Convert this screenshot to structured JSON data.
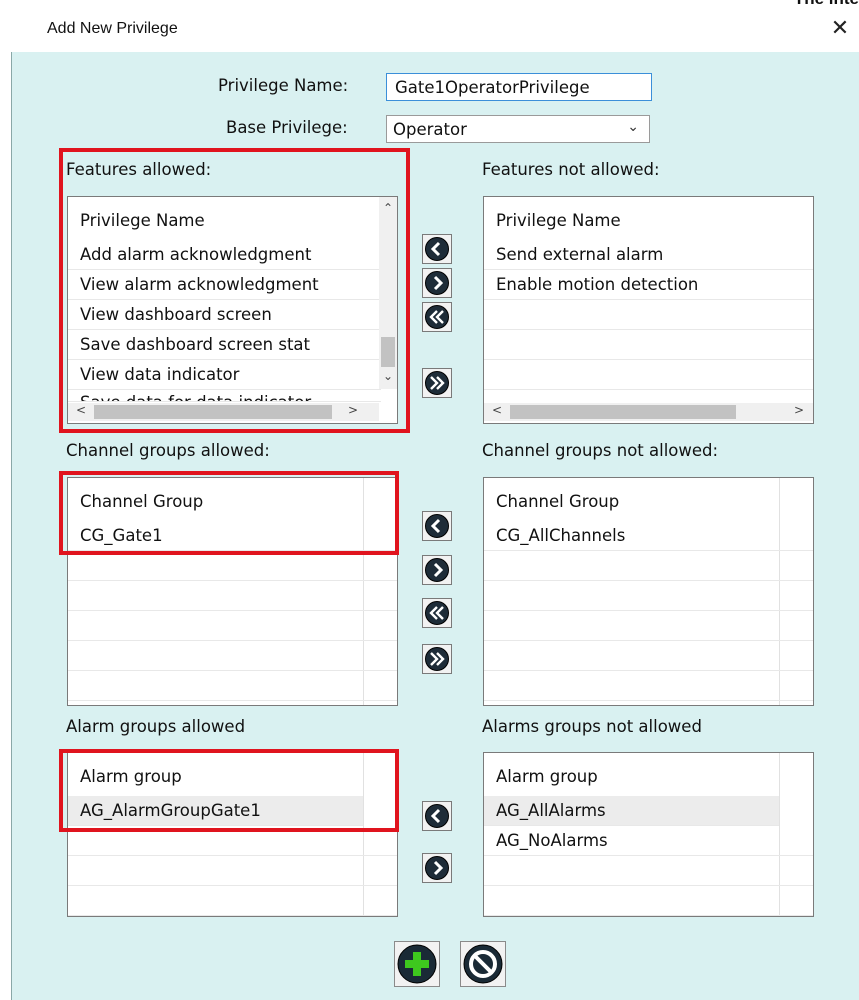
{
  "cropped_top_text": "The inte",
  "window": {
    "title": "Add New Privilege",
    "close": "✕"
  },
  "form": {
    "name_label": "Privilege Name:",
    "name_value": "Gate1OperatorPrivilege",
    "base_label": "Base Privilege:",
    "base_value": "Operator"
  },
  "features": {
    "allowed_label": "Features allowed:",
    "not_allowed_label": "Features not allowed:",
    "allowed_header": "Privilege Name",
    "allowed_rows": [
      "Add alarm acknowledgment",
      "View alarm acknowledgment",
      "View dashboard screen",
      "Save dashboard screen stat",
      "View data indicator",
      "Save data for data indicator"
    ],
    "not_allowed_header": "Privilege Name",
    "not_allowed_rows": [
      "Send external alarm",
      "Enable motion detection"
    ]
  },
  "channels": {
    "allowed_label": "Channel groups allowed:",
    "not_allowed_label": "Channel groups not allowed:",
    "allowed_header": "Channel Group",
    "allowed_rows": [
      "CG_Gate1"
    ],
    "not_allowed_header": "Channel Group",
    "not_allowed_rows": [
      "CG_AllChannels"
    ]
  },
  "alarms": {
    "allowed_label": "Alarm groups allowed",
    "not_allowed_label": "Alarms groups not allowed",
    "allowed_header": "Alarm group",
    "allowed_rows": [
      "AG_AlarmGroupGate1"
    ],
    "not_allowed_header": "Alarm group",
    "not_allowed_rows": [
      "AG_AllAlarms",
      "AG_NoAlarms"
    ]
  },
  "icons": {
    "move_left": "arrow-left-icon",
    "move_right": "arrow-right-icon",
    "move_all_left": "double-arrow-left-icon",
    "move_all_right": "double-arrow-right-icon",
    "add": "plus-icon",
    "cancel": "cancel-icon"
  },
  "colors": {
    "dialog_bg": "#d9f1f1",
    "highlight": "#e0141e",
    "add_green": "#3ec81e"
  }
}
